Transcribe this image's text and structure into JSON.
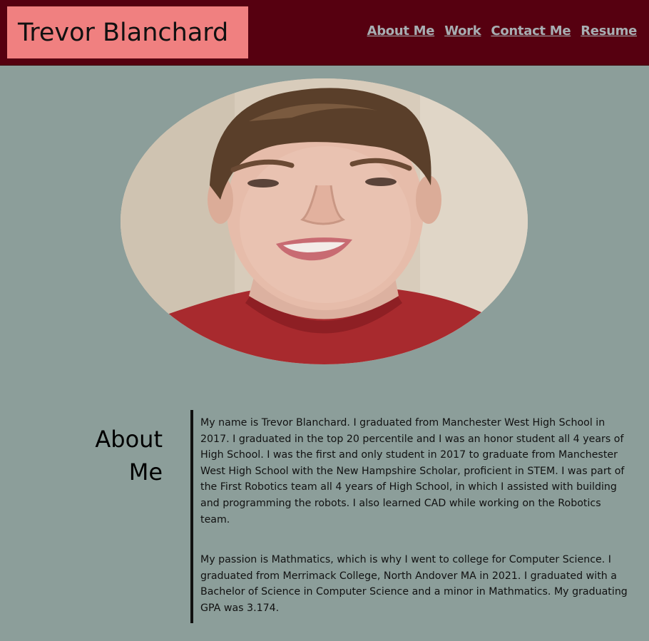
{
  "header": {
    "brand": "Trevor Blanchard",
    "nav": [
      "About Me",
      "Work",
      "Contact Me",
      "Resume"
    ]
  },
  "profile_photo": {
    "alt": "Trevor Blanchard"
  },
  "about": {
    "heading_line1": "About",
    "heading_line2": "Me",
    "paragraph1": "My name is Trevor Blanchard. I graduated from Manchester West High School in 2017. I graduated in the top 20 percentile and I was an honor student all 4 years of High School. I was the first and only student in 2017 to graduate from Manchester West High School with the New Hampshire Scholar, proficient in STEM. I was part of the First Robotics team all 4 years of High School, in which I assisted with building and programming the robots. I also learned CAD while working on the Robotics team.",
    "paragraph2": "My passion is Mathmatics, which is why I went to college for Computer Science. I graduated from Merrimack College, North Andover MA in 2021. I graduated with a Bachelor of Science in Computer Science and a minor in Mathmatics. My graduating GPA was 3.174."
  },
  "colors": {
    "header_bg": "#560010",
    "brand_bg": "#f08080",
    "page_bg": "#8c9e9a",
    "nav_link": "#a7aeb2"
  }
}
